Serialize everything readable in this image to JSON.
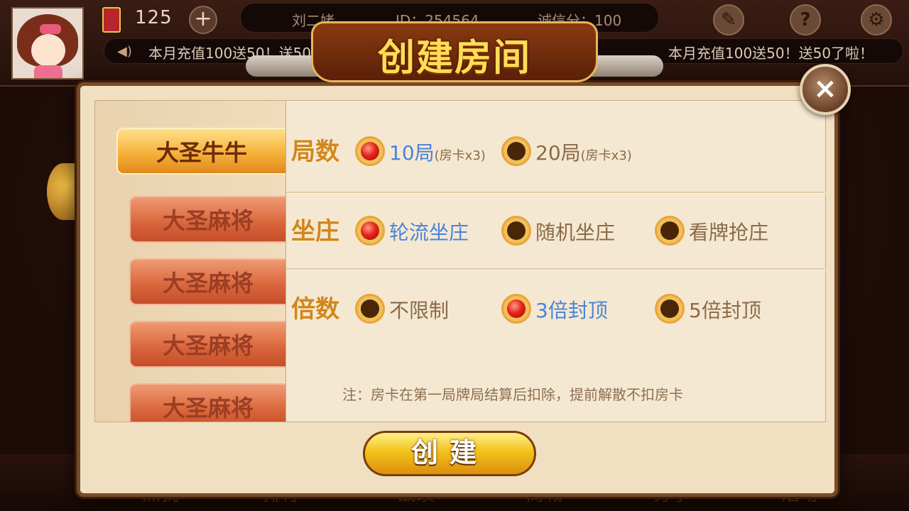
{
  "header": {
    "card_count": "125",
    "plus_label": "+",
    "player_name": "刘二姥",
    "player_id": "ID：254564",
    "credit": "诚信分：100",
    "icons": [
      "edit-icon",
      "help-icon",
      "gear-icon"
    ]
  },
  "ticker": {
    "text_1": "本月充值100送50！送50了啦！",
    "text_2": "本月充值100送50！送50了啦！"
  },
  "bottom_nav": [
    "点我",
    "排行",
    "战绩",
    "商城",
    "分享",
    "活动"
  ],
  "dialog": {
    "title": "创建房间",
    "close_label": "×",
    "tabs": [
      "大圣牛牛",
      "大圣麻将",
      "大圣麻将",
      "大圣麻将",
      "大圣麻将"
    ],
    "active_tab": 0,
    "rows": [
      {
        "label": "局数",
        "options": [
          {
            "text": "10局",
            "sub": "(房卡x3)",
            "selected": true
          },
          {
            "text": "20局",
            "sub": "(房卡x3)",
            "selected": false
          }
        ]
      },
      {
        "label": "坐庄",
        "options": [
          {
            "text": "轮流坐庄",
            "selected": true
          },
          {
            "text": "随机坐庄",
            "selected": false
          },
          {
            "text": "看牌抢庄",
            "selected": false
          }
        ]
      },
      {
        "label": "倍数",
        "options": [
          {
            "text": "不限制",
            "selected": false
          },
          {
            "text": "3倍封顶",
            "selected": true
          },
          {
            "text": "5倍封顶",
            "selected": false
          }
        ]
      }
    ],
    "note": "注：房卡在第一局牌局结算后扣除，提前解散不扣房卡",
    "create_label": "创建"
  },
  "colors": {
    "label_gold": "#d1861c",
    "selected_text": "#4a83d8",
    "title_yellow": "#ffdd55"
  }
}
